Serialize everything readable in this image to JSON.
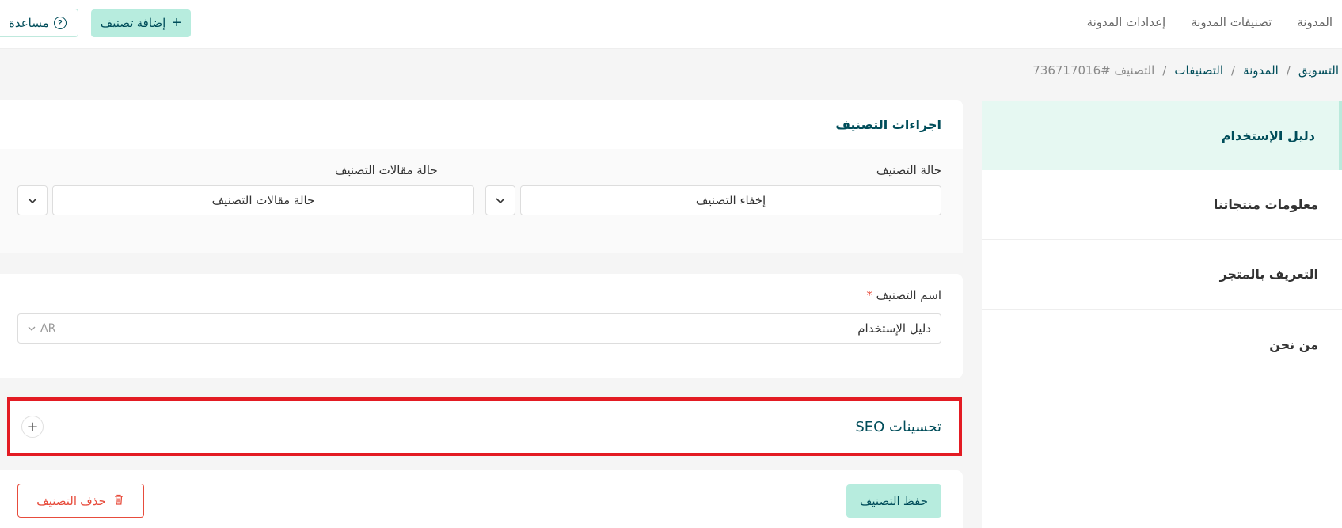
{
  "topbar": {
    "nav": [
      "المدونة",
      "تصنيفات المدونة",
      "إعدادات المدونة"
    ],
    "help_label": "مساعدة",
    "add_label": "إضافة تصنيف"
  },
  "breadcrumb": {
    "items": [
      "التسويق",
      "المدونة",
      "التصنيفات"
    ],
    "separator": "/",
    "current": "التصنيف #736717016"
  },
  "sidebar": {
    "items": [
      "دليل الإستخدام",
      "معلومات منتجاتنا",
      "التعريف بالمتجر",
      "من نحن"
    ],
    "active_index": 0
  },
  "actions_card": {
    "title": "اجراءات التصنيف",
    "status_label": "حالة التصنيف",
    "status_value": "إخفاء التصنيف",
    "articles_status_label": "حالة مقالات التصنيف",
    "articles_status_value": "حالة مقالات التصنيف"
  },
  "name_card": {
    "label": "اسم التصنيف",
    "required_mark": "*",
    "value": "دليل الإستخدام",
    "lang": "AR"
  },
  "seo_card": {
    "title": "تحسينات SEO",
    "toggle": "+"
  },
  "footer": {
    "save_label": "حفظ التصنيف",
    "delete_label": "حذف التصنيف"
  },
  "colors": {
    "accent": "#b7ecde",
    "primary_text": "#004d5a",
    "danger": "#e74c3c",
    "highlight_border": "#e31b23"
  }
}
